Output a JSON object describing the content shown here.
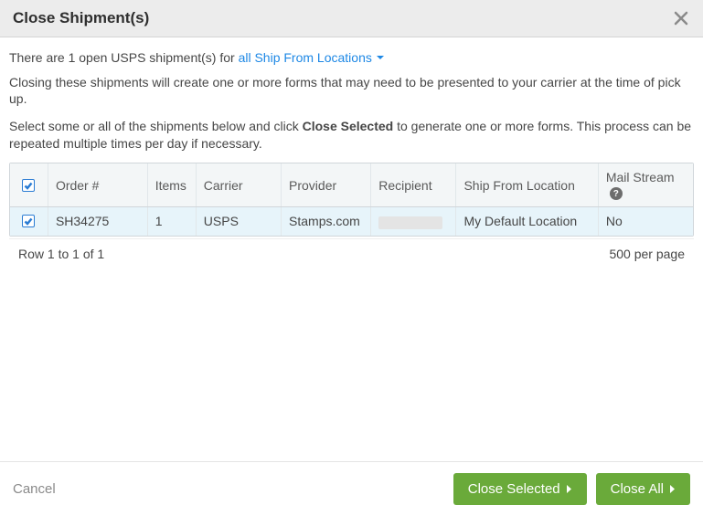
{
  "header": {
    "title": "Close Shipment(s)"
  },
  "intro": {
    "prefix": "There are 1 open USPS shipment(s) for",
    "dropdown_label": "all Ship From Locations"
  },
  "paragraph1": "Closing these shipments will create one or more forms that may need to be presented to your carrier at the time of pick up.",
  "paragraph2": {
    "pre": "Select some or all of the shipments below and click ",
    "bold": "Close Selected",
    "post": " to generate one or more forms. This process can be repeated multiple times per day if necessary."
  },
  "table": {
    "columns": {
      "order": "Order #",
      "items": "Items",
      "carrier": "Carrier",
      "provider": "Provider",
      "recipient": "Recipient",
      "ship_from": "Ship From Location",
      "mail_stream": "Mail Stream"
    },
    "rows": [
      {
        "order": "SH34275",
        "items": "1",
        "carrier": "USPS",
        "provider": "Stamps.com",
        "recipient": "",
        "ship_from": "My Default Location",
        "mail_stream": "No"
      }
    ],
    "footer": {
      "range": "Row 1 to 1 of 1",
      "per_page": "500 per page"
    }
  },
  "footer": {
    "cancel": "Cancel",
    "close_selected": "Close Selected",
    "close_all": "Close All"
  }
}
